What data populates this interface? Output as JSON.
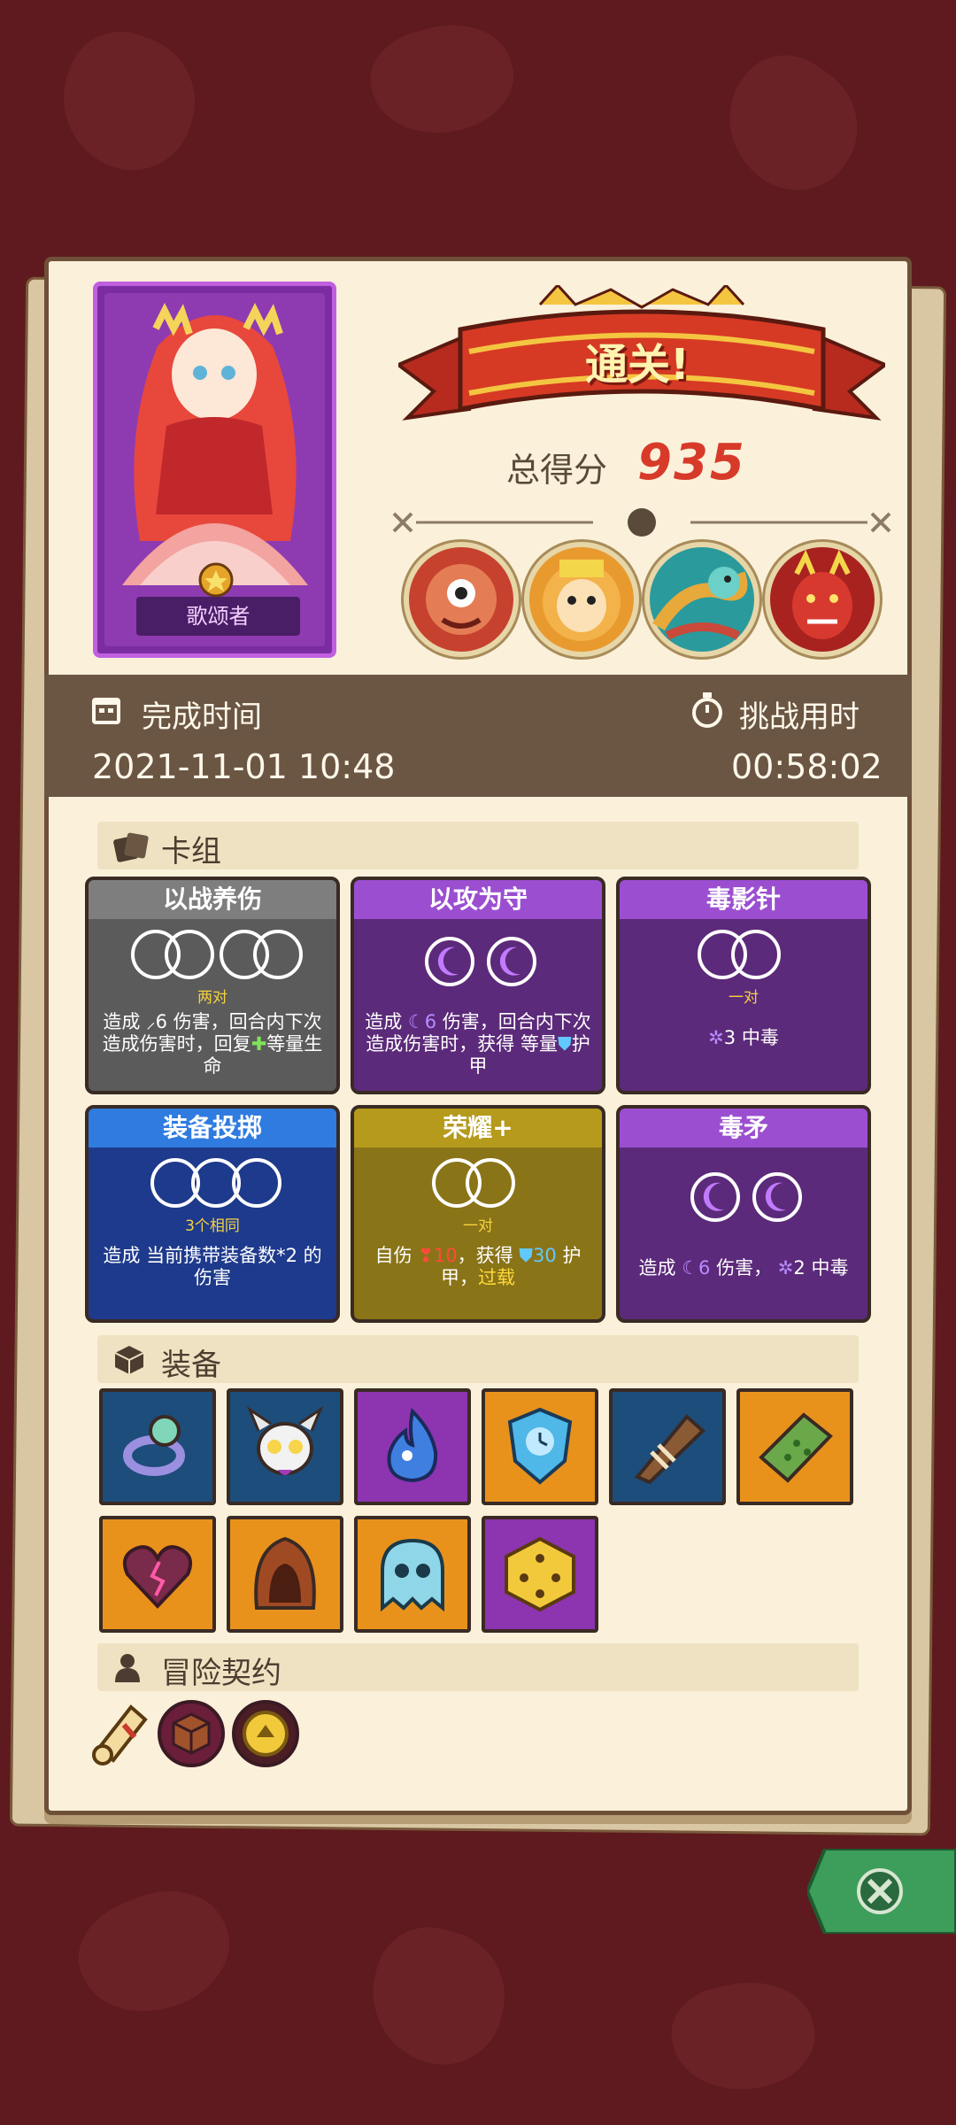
{
  "hero": {
    "name": "歌颂者",
    "art": "singer-hero-portrait",
    "medal_icon": "medal-icon"
  },
  "result": {
    "title": "通关!",
    "score_label": "总得分",
    "score": "935"
  },
  "bosses": [
    "cyclops-boss-icon",
    "lion-warrior-boss-icon",
    "serpent-boss-icon",
    "red-demon-boss-icon"
  ],
  "stats": {
    "finish_time_label": "完成时间",
    "finish_time": "2021-11-01 10:48",
    "challenge_time_label": "挑战用时",
    "challenge_time": "00:58:02"
  },
  "deck": {
    "title": "卡组",
    "cards": [
      {
        "name": "以战养伤",
        "requirement": "两对",
        "desc_parts": [
          "造成",
          "6",
          "伤害，回合内下次造成伤害时，回复",
          "等量生命"
        ],
        "theme": "gray"
      },
      {
        "name": "以攻为守",
        "requirement": "",
        "desc_parts": [
          "造成",
          "6",
          "伤害，回合内下次造成伤害时，获得 等量",
          "护甲"
        ],
        "theme": "purple"
      },
      {
        "name": "毒影针",
        "requirement": "一对",
        "desc_parts": [
          "3",
          "中毒"
        ],
        "theme": "purple"
      },
      {
        "name": "装备投掷",
        "requirement": "3个相同",
        "desc_parts": [
          "造成 当前携带装备数*2 的伤害"
        ],
        "theme": "blue"
      },
      {
        "name": "荣耀+",
        "requirement": "一对",
        "desc_parts": [
          "自伤",
          "10",
          "，获得",
          "30",
          "护甲，",
          "过载"
        ],
        "theme": "gold"
      },
      {
        "name": "毒矛",
        "requirement": "",
        "desc_parts": [
          "造成",
          "6",
          "伤害，",
          "2",
          "中毒"
        ],
        "theme": "purple"
      }
    ]
  },
  "equipment": {
    "title": "装备",
    "items": [
      {
        "icon": "ring-icon",
        "bg": "#1d4d7a"
      },
      {
        "icon": "horned-skull-icon",
        "bg": "#1d4d7a"
      },
      {
        "icon": "blue-flame-icon",
        "bg": "#8d34b0"
      },
      {
        "icon": "clock-shield-icon",
        "bg": "#e8921c"
      },
      {
        "icon": "war-horn-icon",
        "bg": "#1d4d7a"
      },
      {
        "icon": "green-slab-icon",
        "bg": "#e8921c"
      },
      {
        "icon": "cracked-heart-icon",
        "bg": "#e8921c"
      },
      {
        "icon": "hood-icon",
        "bg": "#e8921c"
      },
      {
        "icon": "ghost-icon",
        "bg": "#e8921c"
      },
      {
        "icon": "gold-dice-icon",
        "bg": "#8d34b0"
      }
    ]
  },
  "contracts": {
    "title": "冒险契约",
    "items": [
      "scroll-icon",
      "cube-seal-icon",
      "gold-coin-icon"
    ]
  },
  "close": {
    "icon": "close-icon"
  }
}
